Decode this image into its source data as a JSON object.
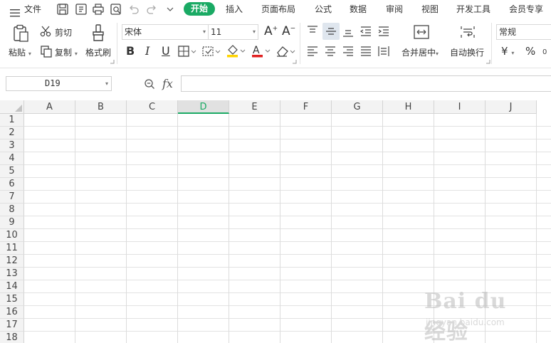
{
  "menubar": {
    "file_label": "文件",
    "tabs": [
      "开始",
      "插入",
      "页面布局",
      "公式",
      "数据",
      "审阅",
      "视图",
      "开发工具",
      "会员专享"
    ],
    "active_tab": "开始"
  },
  "ribbon": {
    "paste_label": "粘贴",
    "cut_label": "剪切",
    "copy_label": "复制",
    "format_painter_label": "格式刷",
    "font_name": "宋体",
    "font_size": "11",
    "bold_glyph": "B",
    "italic_glyph": "I",
    "underline_glyph": "U",
    "grow_font_glyph": "A",
    "shrink_font_glyph": "A",
    "font_color_glyph": "A",
    "merge_center_label": "合并居中",
    "wrap_text_label": "自动换行",
    "number_format": "常规",
    "currency_glyph": "¥",
    "percent_glyph": "%",
    "accent_color": "#1aaa64",
    "font_color_bar": "#e02020",
    "fill_color_bar": "#ffd400"
  },
  "formula_bar": {
    "cell_ref": "D19",
    "zoom_icon": "magnifier-icon",
    "fx_label": "fx",
    "formula_value": ""
  },
  "sheet": {
    "columns": [
      "A",
      "B",
      "C",
      "D",
      "E",
      "F",
      "G",
      "H",
      "I",
      "J"
    ],
    "rows": [
      "1",
      "2",
      "3",
      "4",
      "5",
      "6",
      "7",
      "8",
      "9",
      "10",
      "11",
      "12",
      "13",
      "14",
      "15",
      "16",
      "17",
      "18"
    ],
    "selected_column": "D"
  },
  "watermark": {
    "text": "Bai du 经验",
    "sub": "jingyan.baidu.com"
  }
}
